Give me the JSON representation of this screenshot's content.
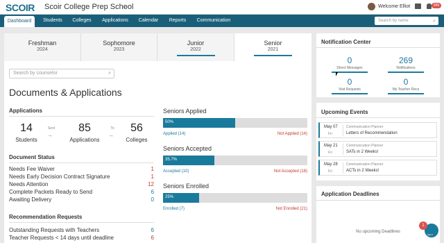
{
  "topbar": {
    "logo": "SCOIR",
    "school": "Scoir College Prep School",
    "welcome": "Welcome Elliot",
    "notif_badge": "999"
  },
  "nav": {
    "items": [
      "Dashboard",
      "Students",
      "Colleges",
      "Applications",
      "Calendar",
      "Reports",
      "Communication"
    ],
    "search_placeholder": "Search by name"
  },
  "years": [
    {
      "name": "Freshman",
      "year": "2024"
    },
    {
      "name": "Sophomore",
      "year": "2023"
    },
    {
      "name": "Junior",
      "year": "2022"
    },
    {
      "name": "Senior",
      "year": "2021"
    }
  ],
  "counselor_placeholder": "Search by counselor",
  "title": "Documents & Applications",
  "applications": {
    "heading": "Applications",
    "students_num": "14",
    "students_lbl": "Students",
    "sent_lbl": "Sent",
    "apps_num": "85",
    "apps_lbl": "Applications",
    "to_lbl": "To",
    "colleges_num": "56",
    "colleges_lbl": "Colleges"
  },
  "doc_status": {
    "heading": "Document Status",
    "rows": [
      {
        "label": "Needs Fee Waiver",
        "value": "1"
      },
      {
        "label": "Needs Early Decision Contract Signature",
        "value": "1"
      },
      {
        "label": "Needs Attention",
        "value": "12"
      },
      {
        "label": "Complete Packets Ready to Send",
        "value": "6"
      },
      {
        "label": "Awaiting Delivery",
        "value": "0"
      }
    ]
  },
  "recs": {
    "heading": "Recommendation Requests",
    "rows": [
      {
        "label": "Outstanding Requests with Teachers",
        "value": "6"
      },
      {
        "label": "Teacher Requests < 14 days until deadline",
        "value": "6"
      }
    ]
  },
  "seniors": [
    {
      "heading": "Seniors Applied",
      "pct": 50,
      "pct_lbl": "50%",
      "left": "Applied (14)",
      "right": "Not Applied (14)"
    },
    {
      "heading": "Seniors Accepted",
      "pct": 35.7,
      "pct_lbl": "35.7%",
      "left": "Accepted (10)",
      "right": "Not Accepted (18)"
    },
    {
      "heading": "Seniors Enrolled",
      "pct": 25,
      "pct_lbl": "25%",
      "left": "Enrolled (7)",
      "right": "Not Enrolled (21)"
    }
  ],
  "notifications": {
    "heading": "Notification Center",
    "items": [
      {
        "num": "0",
        "label": "Direct Messages"
      },
      {
        "num": "269",
        "label": "Notifications"
      },
      {
        "num": "0",
        "label": "Visit Requests"
      },
      {
        "num": "0",
        "label": "My Teacher Recs"
      }
    ]
  },
  "events": {
    "heading": "Upcoming Events",
    "items": [
      {
        "date": "May 07",
        "dow": "Fri",
        "cat": "Communication Planner",
        "title": "Letters of Recommendation"
      },
      {
        "date": "May 21",
        "dow": "Fri",
        "cat": "Communication Planner",
        "title": "SATs in 2 Weeks!"
      },
      {
        "date": "May 28",
        "dow": "Fri",
        "cat": "Communication Planner",
        "title": "ACTs in 2 Weeks!"
      }
    ]
  },
  "deadlines": {
    "heading": "Application Deadlines",
    "empty": "No upcoming Deadlines"
  },
  "help": {
    "badge": "1",
    "label": "HELP"
  },
  "colors": {
    "brand": "#1a5f7a",
    "accent": "#1a7a9b",
    "alert": "#c0392b"
  }
}
